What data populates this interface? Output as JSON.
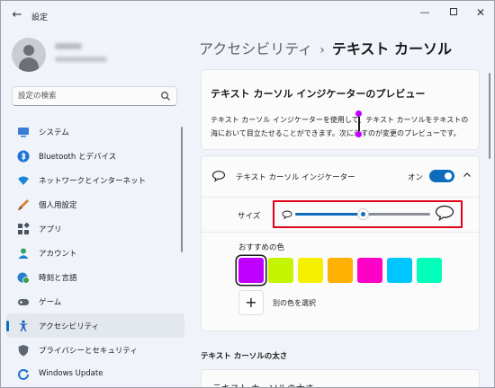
{
  "window": {
    "title": "設定",
    "back_icon": "arrow-left-icon",
    "controls": [
      "minimize",
      "maximize",
      "close"
    ]
  },
  "search": {
    "placeholder": "設定の検索"
  },
  "sidebar": {
    "items": [
      {
        "label": "システム",
        "icon": "monitor-icon",
        "color": "#3a7bd5"
      },
      {
        "label": "Bluetooth とデバイス",
        "icon": "bluetooth-icon",
        "color": "#1c74d8"
      },
      {
        "label": "ネットワークとインターネット",
        "icon": "wifi-icon",
        "color": "#1e86d9"
      },
      {
        "label": "個人用設定",
        "icon": "brush-icon",
        "color": "#d9822b"
      },
      {
        "label": "アプリ",
        "icon": "apps-icon",
        "color": "#4a5360"
      },
      {
        "label": "アカウント",
        "icon": "account-icon",
        "color": "#2fa36b"
      },
      {
        "label": "時刻と言語",
        "icon": "globe-clock-icon",
        "color": "#2a7fd4"
      },
      {
        "label": "ゲーム",
        "icon": "gamepad-icon",
        "color": "#5a626c"
      },
      {
        "label": "アクセシビリティ",
        "icon": "accessibility-icon",
        "color": "#1b5fb5",
        "active": true
      },
      {
        "label": "プライバシーとセキュリティ",
        "icon": "shield-icon",
        "color": "#5d6670"
      },
      {
        "label": "Windows Update",
        "icon": "windows-update-icon",
        "color": "#1b74d3"
      }
    ]
  },
  "breadcrumb": {
    "parent": "アクセシビリティ",
    "separator": "›",
    "current": "テキスト カーソル"
  },
  "preview": {
    "title": "テキスト カーソル インジケーターのプレビュー",
    "description": "テキスト カーソル インジケーターを使用して、テキスト カーソルをテキストの海において目立たせることができます。次に示すのが変更のプレビューです。"
  },
  "indicator": {
    "label": "テキスト カーソル インジケーター",
    "toggle_label": "オン",
    "toggle_on": true,
    "size_label": "サイズ",
    "size_level": 0.5,
    "recommended_title": "おすすめの色",
    "swatches": [
      "#c000ff",
      "#c5f400",
      "#f4f000",
      "#ffb000",
      "#ff00c6",
      "#00c6ff",
      "#00ffb8"
    ],
    "selected_swatch": 0,
    "add_color_label": "別の色を選択",
    "accent_color": "#0f6cbd",
    "highlight_color": "#e0001a"
  },
  "thickness": {
    "heading": "テキスト カーソルの太さ",
    "card_label": "テキスト カーソルの太さ"
  }
}
